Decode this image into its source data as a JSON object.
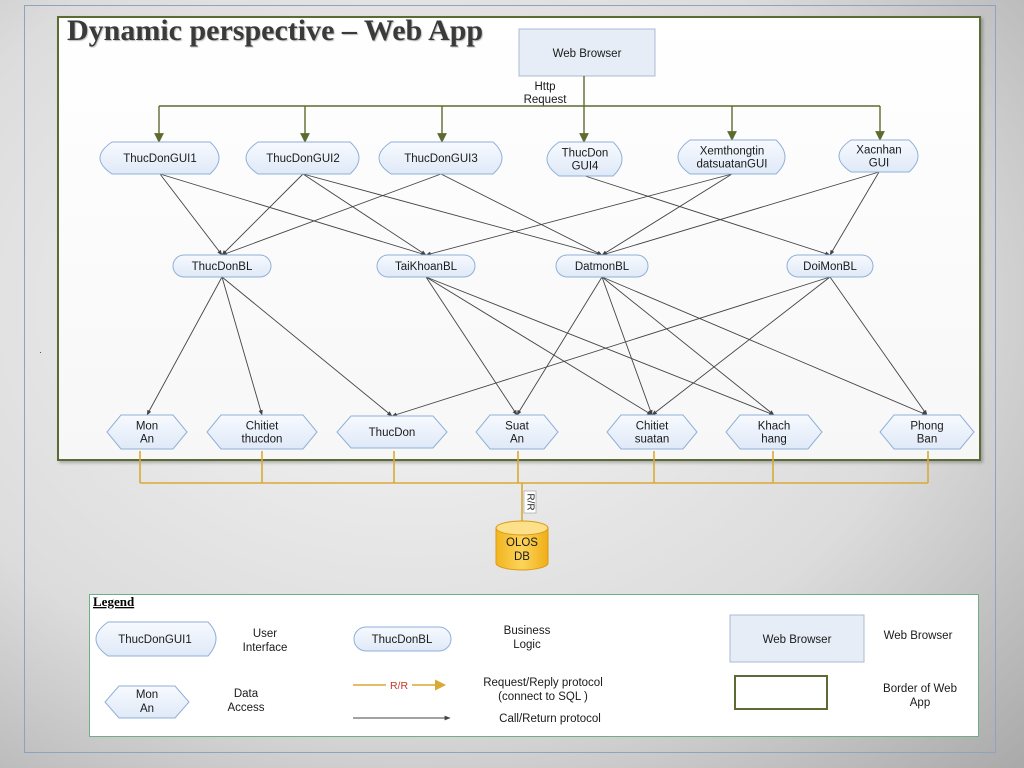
{
  "title": "Dynamic perspective – Web App",
  "browser": {
    "label": "Web Browser"
  },
  "http_label": [
    "Http",
    "Request"
  ],
  "gui": [
    {
      "id": "g1",
      "lines": [
        "ThucDonGUI1"
      ]
    },
    {
      "id": "g2",
      "lines": [
        "ThucDonGUI2"
      ]
    },
    {
      "id": "g3",
      "lines": [
        "ThucDonGUI3"
      ]
    },
    {
      "id": "g4",
      "lines": [
        "ThucDon",
        "GUI4"
      ]
    },
    {
      "id": "g5",
      "lines": [
        "Xemthongtin",
        "datsuatanGUI"
      ]
    },
    {
      "id": "g6",
      "lines": [
        "Xacnhan",
        "GUI"
      ]
    }
  ],
  "bl": [
    {
      "id": "b1",
      "lines": [
        "ThucDonBL"
      ]
    },
    {
      "id": "b2",
      "lines": [
        "TaiKhoanBL"
      ]
    },
    {
      "id": "b3",
      "lines": [
        "DatmonBL"
      ]
    },
    {
      "id": "b4",
      "lines": [
        "DoiMonBL"
      ]
    }
  ],
  "da": [
    {
      "id": "d1",
      "lines": [
        "Mon",
        "An"
      ]
    },
    {
      "id": "d2",
      "lines": [
        "Chitiet",
        "thucdon"
      ]
    },
    {
      "id": "d3",
      "lines": [
        "ThucDon"
      ]
    },
    {
      "id": "d4",
      "lines": [
        "Suat",
        "An"
      ]
    },
    {
      "id": "d5",
      "lines": [
        "Chitiet",
        "suatan"
      ]
    },
    {
      "id": "d6",
      "lines": [
        "Khach",
        "hang"
      ]
    },
    {
      "id": "d7",
      "lines": [
        "Phong",
        "Ban"
      ]
    }
  ],
  "rr_label": "R/R",
  "db": {
    "lines": [
      "OLOS",
      "DB"
    ]
  },
  "edges_gui_bl": [
    [
      "g1",
      "b1"
    ],
    [
      "g1",
      "b2"
    ],
    [
      "g2",
      "b1"
    ],
    [
      "g2",
      "b2"
    ],
    [
      "g2",
      "b3"
    ],
    [
      "g3",
      "b1"
    ],
    [
      "g3",
      "b3"
    ],
    [
      "g4",
      "b4"
    ],
    [
      "g5",
      "b2"
    ],
    [
      "g5",
      "b3"
    ],
    [
      "g6",
      "b3"
    ],
    [
      "g6",
      "b4"
    ]
  ],
  "edges_bl_da": [
    [
      "b1",
      "d1"
    ],
    [
      "b1",
      "d2"
    ],
    [
      "b1",
      "d3"
    ],
    [
      "b2",
      "d4"
    ],
    [
      "b2",
      "d5"
    ],
    [
      "b2",
      "d6"
    ],
    [
      "b3",
      "d4"
    ],
    [
      "b3",
      "d5"
    ],
    [
      "b3",
      "d6"
    ],
    [
      "b3",
      "d7"
    ],
    [
      "b4",
      "d3"
    ],
    [
      "b4",
      "d5"
    ],
    [
      "b4",
      "d7"
    ]
  ],
  "legend": {
    "title": "Legend",
    "ui_sample": "ThucDonGUI1",
    "ui_desc": [
      "User",
      "Interface"
    ],
    "bl_sample": "ThucDonBL",
    "bl_desc": [
      "Business",
      "Logic"
    ],
    "wb_sample": "Web Browser",
    "wb_desc": "Web Browser",
    "da_sample": [
      "Mon",
      "An"
    ],
    "da_desc": [
      "Data",
      "Access"
    ],
    "rr_sample": "R/R",
    "rr_desc": [
      "Request/Reply protocol",
      "(connect to SQL )"
    ],
    "call_desc": "Call/Return protocol",
    "border_desc": [
      "Border of Web",
      "App"
    ]
  },
  "colors": {
    "green_arrow": "#5d6b2f",
    "gold": "#d9a935",
    "node_fill": "#eaf1fb",
    "node_stroke": "#8fb0d8",
    "webapp_border": "#5b6b33",
    "db_fill": "#f7c335",
    "line": "#444444"
  }
}
